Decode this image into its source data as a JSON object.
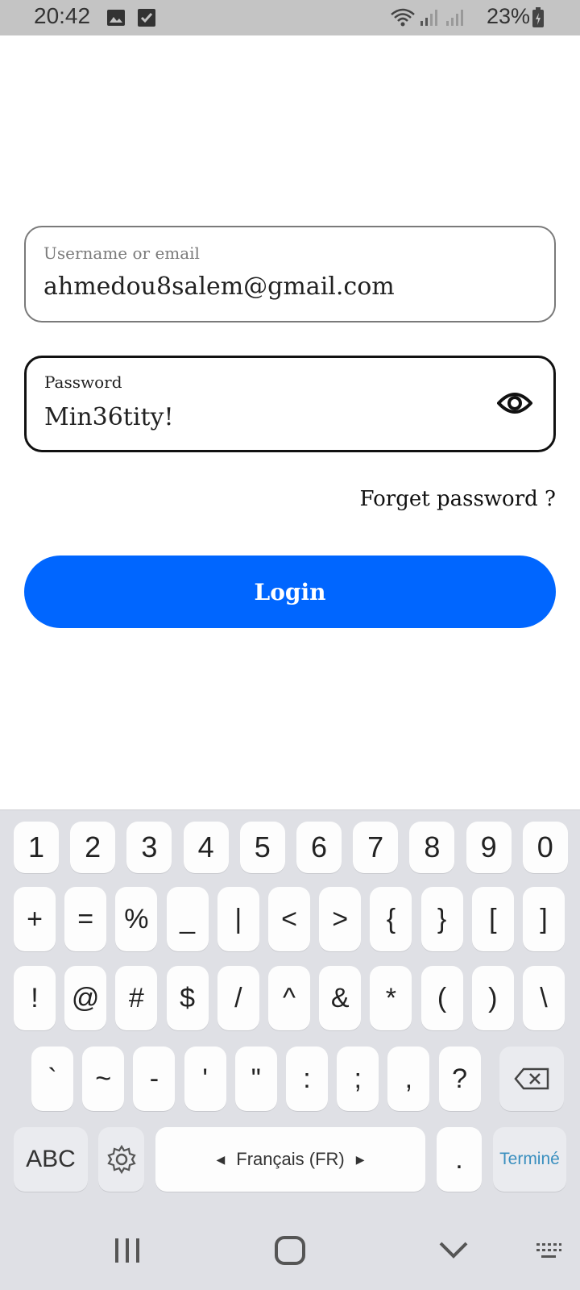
{
  "status_bar": {
    "time": "20:42",
    "battery_percent": "23%",
    "icons": [
      "gallery-icon",
      "checkbox-icon",
      "wifi-icon",
      "signal-icon",
      "signal-icon",
      "battery-charging-icon"
    ]
  },
  "login_form": {
    "username": {
      "label": "Username or email",
      "value": "ahmedou8salem@gmail.com"
    },
    "password": {
      "label": "Password",
      "value": "Min36tity!",
      "toggle_icon": "eye-icon"
    },
    "forgot_link": "Forget password ?",
    "login_button": "Login",
    "colors": {
      "button": "#0066ff",
      "focused_border": "#111111",
      "idle_border": "#7a7a7a"
    }
  },
  "keyboard": {
    "row1": [
      "1",
      "2",
      "3",
      "4",
      "5",
      "6",
      "7",
      "8",
      "9",
      "0"
    ],
    "row2": [
      "+",
      "=",
      "%",
      "_",
      "|",
      "<",
      ">",
      "{",
      "}",
      "[",
      "]"
    ],
    "row3": [
      "!",
      "@",
      "#",
      "$",
      "/",
      "^",
      "&",
      "*",
      "(",
      ")",
      "\\"
    ],
    "row4": [
      "`",
      "~",
      "-",
      "'",
      "\"",
      ":",
      ";",
      ",",
      "?"
    ],
    "abc": "ABC",
    "space": "Français (FR)",
    "period": ".",
    "done": "Terminé",
    "icons": [
      "backspace-icon",
      "settings-icon",
      "chevron-left-icon",
      "chevron-right-icon"
    ]
  },
  "navigation_bar": {
    "icons": [
      "recents-icon",
      "home-icon",
      "back-icon",
      "keyboard-icon"
    ]
  }
}
